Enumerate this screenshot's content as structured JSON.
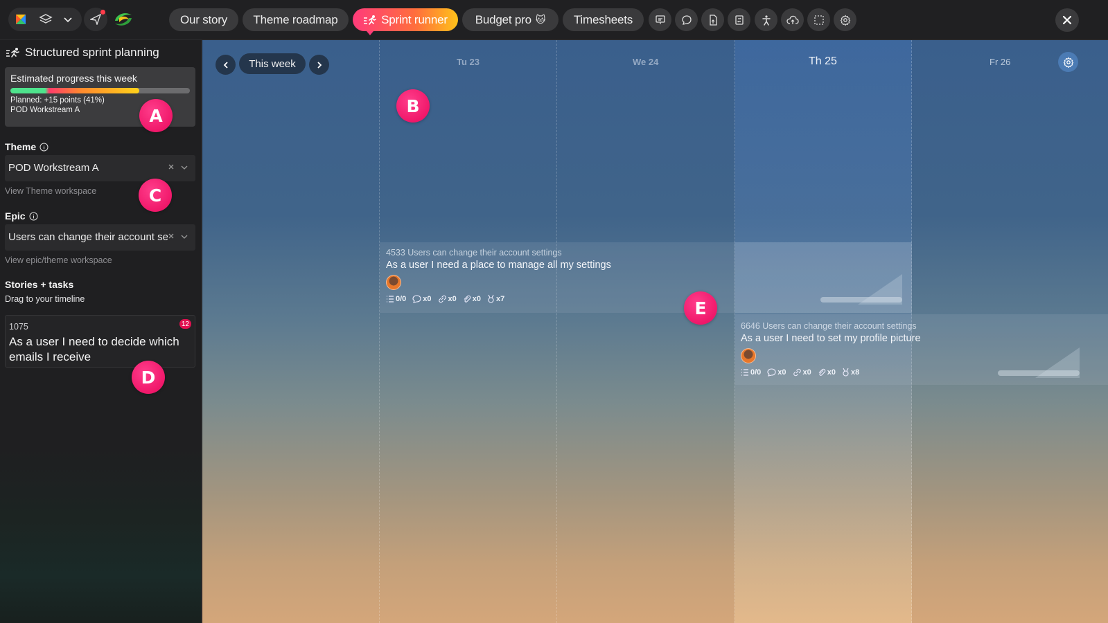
{
  "topbar": {
    "tabs": [
      {
        "label": "Our story",
        "active": false
      },
      {
        "label": "Theme roadmap",
        "active": false
      },
      {
        "label": "Sprint runner",
        "active": true
      },
      {
        "label": "Budget pro",
        "emoji": "🐱",
        "active": false
      },
      {
        "label": "Timesheets",
        "active": false
      }
    ],
    "icon_buttons": [
      "slides-icon",
      "chat-icon",
      "document-icon",
      "transfer-icon",
      "accessibility-icon",
      "cloud-upload-icon",
      "selection-icon",
      "settings-icon"
    ],
    "accent": "#ff3b7a"
  },
  "sidebar": {
    "title": "Structured sprint planning",
    "progress": {
      "title": "Estimated progress this week",
      "percent": 0.72,
      "planned": "Planned: +15 points (41%)",
      "workstream": "POD Workstream A"
    },
    "theme": {
      "label": "Theme",
      "value": "POD Workstream A",
      "link": "View Theme workspace"
    },
    "epic": {
      "label": "Epic",
      "value": "Users can change their account settings",
      "link": "View epic/theme workspace"
    },
    "stories": {
      "label": "Stories + tasks",
      "sub": "Drag to your timeline",
      "card": {
        "id": "1075",
        "text": "As a user I need to decide which emails I receive",
        "badge": "12"
      }
    }
  },
  "calendar": {
    "week_label": "This week",
    "days": [
      {
        "label": "Tu 23"
      },
      {
        "label": "We 24"
      },
      {
        "label": "Th 25",
        "today": true
      },
      {
        "label": "Fr 26"
      }
    ],
    "tasks": [
      {
        "id_line": "4533 Users can change their account settings",
        "title": "As a user I need a place to manage all my settings",
        "stats": {
          "subtasks": "0/0",
          "comments": "x0",
          "links": "x0",
          "attachments": "x0",
          "points": "x7"
        }
      },
      {
        "id_line": "6646 Users can change their account settings",
        "title": "As a user I need to set my profile picture",
        "stats": {
          "subtasks": "0/0",
          "comments": "x0",
          "links": "x0",
          "attachments": "x0",
          "points": "x8"
        }
      }
    ]
  },
  "markers": [
    "A",
    "B",
    "C",
    "D",
    "E"
  ]
}
